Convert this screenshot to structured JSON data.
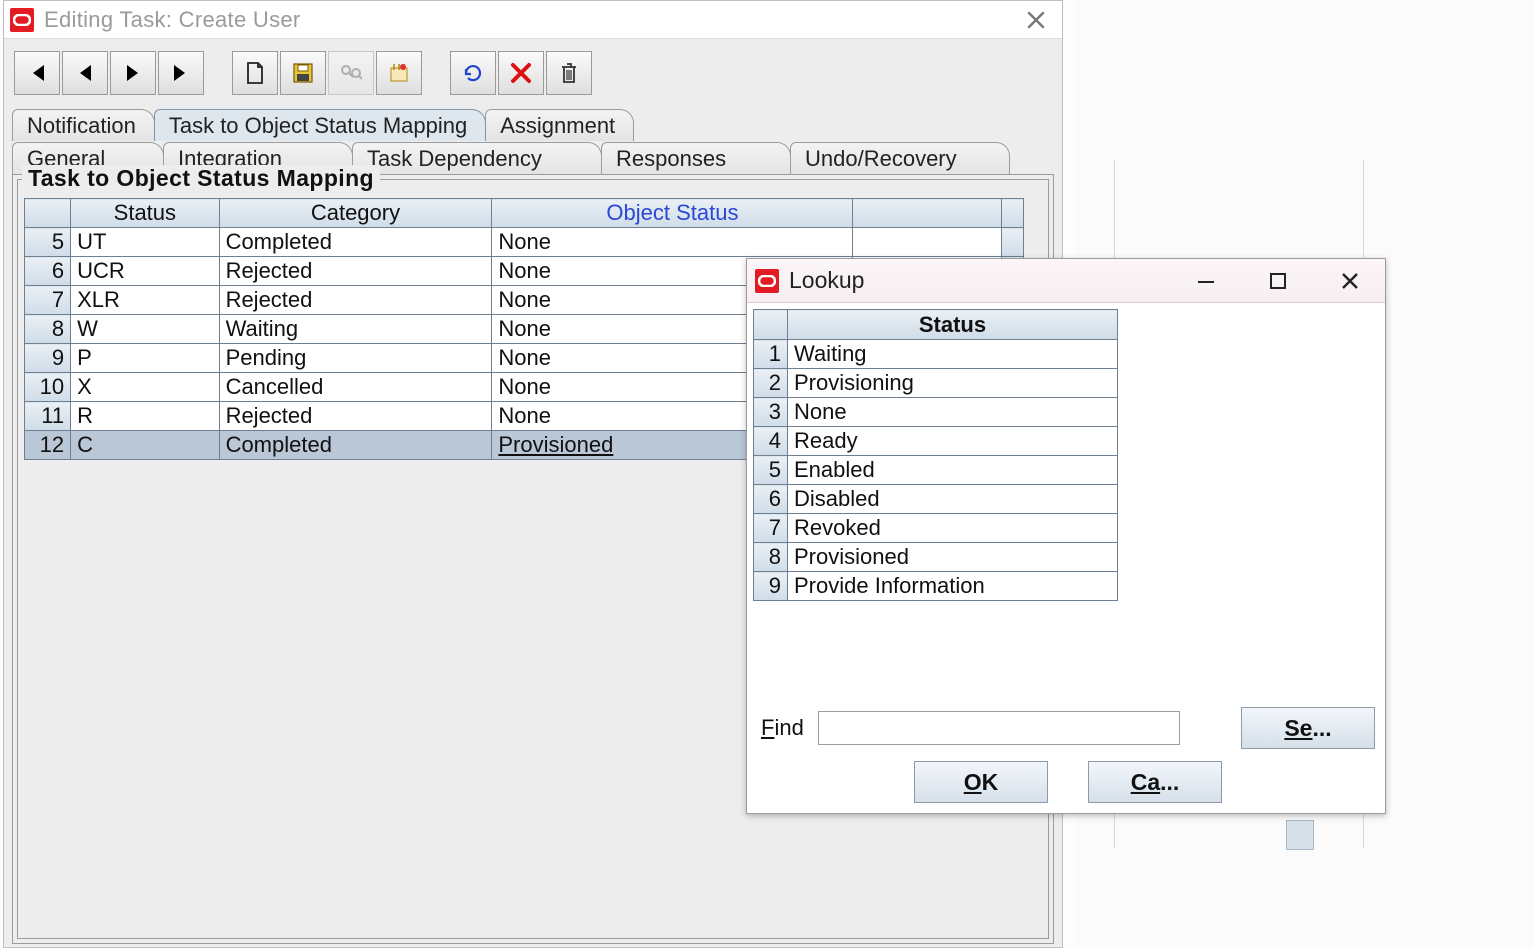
{
  "main": {
    "title": "Editing Task: Create User",
    "tabsUpper": [
      {
        "label": "Notification"
      },
      {
        "label": "Task to Object Status Mapping"
      },
      {
        "label": "Assignment"
      }
    ],
    "activeUpperIndex": 1,
    "tabsLower": [
      {
        "label": "General"
      },
      {
        "label": "Integration"
      },
      {
        "label": "Task Dependency"
      },
      {
        "label": "Responses"
      },
      {
        "label": "Undo/Recovery"
      }
    ],
    "legend": "Task to Object Status Mapping",
    "columns": {
      "status": "Status",
      "category": "Category",
      "objectStatus": "Object Status"
    },
    "rows": [
      {
        "n": "5",
        "status": "UT",
        "category": "Completed",
        "obj": "None"
      },
      {
        "n": "6",
        "status": "UCR",
        "category": "Rejected",
        "obj": "None"
      },
      {
        "n": "7",
        "status": "XLR",
        "category": "Rejected",
        "obj": "None"
      },
      {
        "n": "8",
        "status": "W",
        "category": "Waiting",
        "obj": "None"
      },
      {
        "n": "9",
        "status": "P",
        "category": "Pending",
        "obj": "None"
      },
      {
        "n": "10",
        "status": "X",
        "category": "Cancelled",
        "obj": "None"
      },
      {
        "n": "11",
        "status": "R",
        "category": "Rejected",
        "obj": "None"
      },
      {
        "n": "12",
        "status": "C",
        "category": "Completed",
        "obj": "Provisioned"
      }
    ],
    "selectedRowIndex": 7
  },
  "lookup": {
    "title": "Lookup",
    "header": "Status",
    "rows": [
      {
        "n": "1",
        "v": "Waiting"
      },
      {
        "n": "2",
        "v": "Provisioning"
      },
      {
        "n": "3",
        "v": "None"
      },
      {
        "n": "4",
        "v": "Ready"
      },
      {
        "n": "5",
        "v": "Enabled"
      },
      {
        "n": "6",
        "v": "Disabled"
      },
      {
        "n": "7",
        "v": "Revoked"
      },
      {
        "n": "8",
        "v": "Provisioned"
      },
      {
        "n": "9",
        "v": "Provide Information"
      }
    ],
    "findLabel": "Find",
    "findValue": "",
    "searchButton": "Se...",
    "okButton": "OK",
    "cancelButton": "Ca..."
  }
}
